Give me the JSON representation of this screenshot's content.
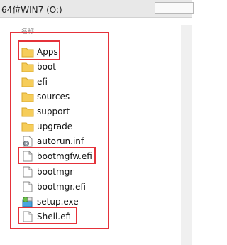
{
  "window": {
    "title": "64位WIN7 (O:)"
  },
  "columns": {
    "name": "名称"
  },
  "files": [
    {
      "name": "Apps",
      "icon": "folder-icon"
    },
    {
      "name": "boot",
      "icon": "folder-icon"
    },
    {
      "name": "efi",
      "icon": "folder-icon"
    },
    {
      "name": "sources",
      "icon": "folder-icon"
    },
    {
      "name": "support",
      "icon": "folder-icon"
    },
    {
      "name": "upgrade",
      "icon": "folder-icon"
    },
    {
      "name": "autorun.inf",
      "icon": "settings-file-icon"
    },
    {
      "name": "bootmgfw.efi",
      "icon": "file-icon"
    },
    {
      "name": "bootmgr",
      "icon": "file-icon"
    },
    {
      "name": "bootmgr.efi",
      "icon": "file-icon"
    },
    {
      "name": "setup.exe",
      "icon": "setup-icon"
    },
    {
      "name": "Shell.efi",
      "icon": "file-icon"
    }
  ],
  "colors": {
    "highlight": "#e5323a",
    "folder": "#f6cd5a"
  }
}
